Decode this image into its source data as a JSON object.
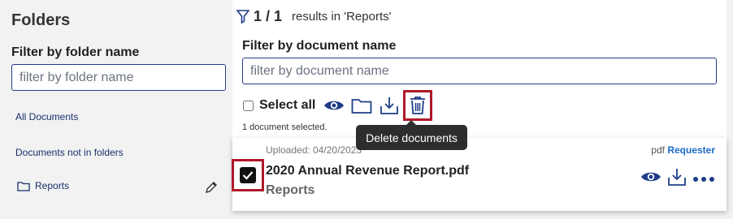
{
  "sidebar": {
    "title": "Folders",
    "filter_label": "Filter by folder name",
    "filter_placeholder": "filter by folder name",
    "links": [
      "All Documents",
      "Documents not in folders"
    ],
    "folders": [
      {
        "name": "Reports"
      }
    ]
  },
  "main": {
    "results_count": "1 / 1",
    "results_label": "results in 'Reports'",
    "doc_filter_label": "Filter by document name",
    "doc_filter_placeholder": "filter by document name",
    "select_all_label": "Select all",
    "selected_info": "1 document selected.",
    "tooltip": "Delete documents"
  },
  "document": {
    "uploaded": "Uploaded: 04/20/2023",
    "title": "2020 Annual Revenue Report.pdf",
    "folder": "Reports",
    "file_type": "pdf",
    "role": "Requester",
    "checked": true
  },
  "colors": {
    "accent": "#1f3c88",
    "highlight": "#b0182a",
    "link": "#1b6ac9"
  }
}
